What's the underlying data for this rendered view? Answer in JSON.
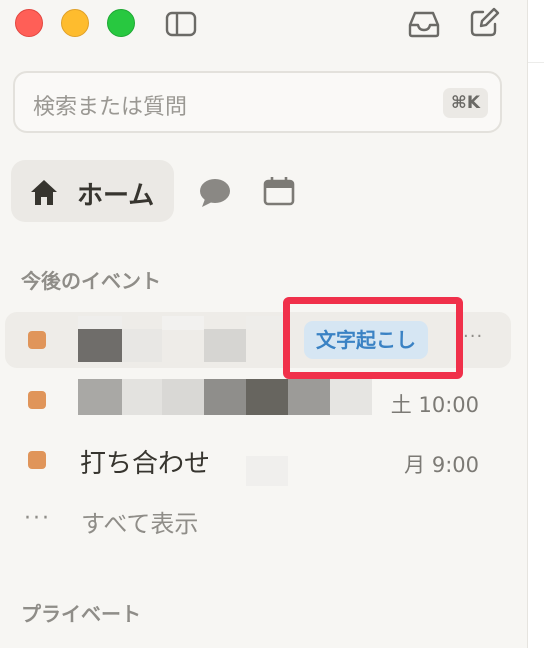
{
  "window": {
    "controls": [
      "close",
      "minimize",
      "zoom"
    ],
    "icons": [
      "sidebar-toggle-icon",
      "inbox-icon",
      "compose-icon"
    ]
  },
  "search": {
    "placeholder": "検索または質問",
    "shortcut": "⌘K"
  },
  "nav": {
    "home_label": "ホーム",
    "icons": [
      "home-icon",
      "chat-bubble-icon",
      "calendar-icon"
    ]
  },
  "events_section": {
    "title": "今後のイベント",
    "events": [
      {
        "title": "",
        "badge": "文字起こし",
        "more": "···",
        "time": "",
        "color": "#e0955a",
        "highlighted": true
      },
      {
        "title": "",
        "time": "土 10:00",
        "color": "#e0955a"
      },
      {
        "title": "打ち合わせ",
        "time": "月 9:00",
        "color": "#e0955a"
      }
    ],
    "show_all_dots": "···",
    "show_all": "すべて表示"
  },
  "private_section": {
    "title": "プライベート"
  },
  "colors": {
    "accent_dot": "#e0955a",
    "badge_bg": "#d6e6f3",
    "badge_text": "#3a82c4",
    "highlight_border": "#f0304a"
  }
}
